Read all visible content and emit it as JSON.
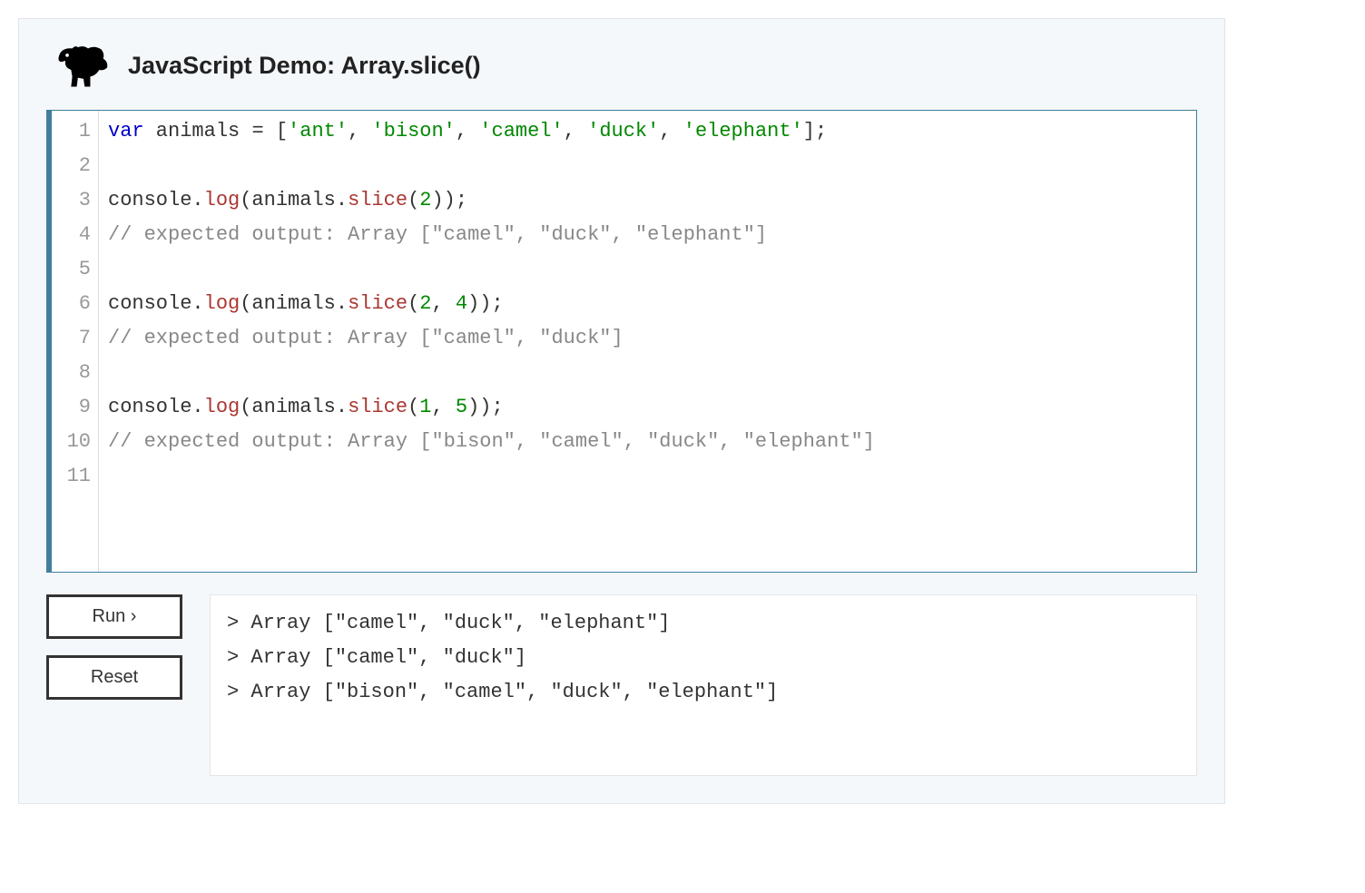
{
  "header": {
    "title": "JavaScript Demo: Array.slice()"
  },
  "editor": {
    "line_numbers": [
      "1",
      "2",
      "3",
      "4",
      "5",
      "6",
      "7",
      "8",
      "9",
      "10",
      "11"
    ],
    "lines": [
      [
        {
          "t": "var",
          "c": "tok-kw"
        },
        {
          "t": " animals ",
          "c": "tok-punc"
        },
        {
          "t": "=",
          "c": "tok-punc"
        },
        {
          "t": " [",
          "c": "tok-punc"
        },
        {
          "t": "'ant'",
          "c": "tok-str"
        },
        {
          "t": ", ",
          "c": "tok-punc"
        },
        {
          "t": "'bison'",
          "c": "tok-str"
        },
        {
          "t": ", ",
          "c": "tok-punc"
        },
        {
          "t": "'camel'",
          "c": "tok-str"
        },
        {
          "t": ", ",
          "c": "tok-punc"
        },
        {
          "t": "'duck'",
          "c": "tok-str"
        },
        {
          "t": ", ",
          "c": "tok-punc"
        },
        {
          "t": "'elephant'",
          "c": "tok-str"
        },
        {
          "t": "];",
          "c": "tok-punc"
        }
      ],
      [],
      [
        {
          "t": "console.",
          "c": "tok-punc"
        },
        {
          "t": "log",
          "c": "tok-method"
        },
        {
          "t": "(animals.",
          "c": "tok-punc"
        },
        {
          "t": "slice",
          "c": "tok-method"
        },
        {
          "t": "(",
          "c": "tok-punc"
        },
        {
          "t": "2",
          "c": "tok-num"
        },
        {
          "t": "));",
          "c": "tok-punc"
        }
      ],
      [
        {
          "t": "// expected output: Array [\"camel\", \"duck\", \"elephant\"]",
          "c": "tok-cmt"
        }
      ],
      [],
      [
        {
          "t": "console.",
          "c": "tok-punc"
        },
        {
          "t": "log",
          "c": "tok-method"
        },
        {
          "t": "(animals.",
          "c": "tok-punc"
        },
        {
          "t": "slice",
          "c": "tok-method"
        },
        {
          "t": "(",
          "c": "tok-punc"
        },
        {
          "t": "2",
          "c": "tok-num"
        },
        {
          "t": ", ",
          "c": "tok-punc"
        },
        {
          "t": "4",
          "c": "tok-num"
        },
        {
          "t": "));",
          "c": "tok-punc"
        }
      ],
      [
        {
          "t": "// expected output: Array [\"camel\", \"duck\"]",
          "c": "tok-cmt"
        }
      ],
      [],
      [
        {
          "t": "console.",
          "c": "tok-punc"
        },
        {
          "t": "log",
          "c": "tok-method"
        },
        {
          "t": "(animals.",
          "c": "tok-punc"
        },
        {
          "t": "slice",
          "c": "tok-method"
        },
        {
          "t": "(",
          "c": "tok-punc"
        },
        {
          "t": "1",
          "c": "tok-num"
        },
        {
          "t": ", ",
          "c": "tok-punc"
        },
        {
          "t": "5",
          "c": "tok-num"
        },
        {
          "t": "));",
          "c": "tok-punc"
        }
      ],
      [
        {
          "t": "// expected output: Array [\"bison\", \"camel\", \"duck\", \"elephant\"]",
          "c": "tok-cmt"
        }
      ],
      []
    ]
  },
  "buttons": {
    "run": "Run ›",
    "reset": "Reset"
  },
  "console": {
    "lines": [
      "> Array [\"camel\", \"duck\", \"elephant\"]",
      "> Array [\"camel\", \"duck\"]",
      "> Array [\"bison\", \"camel\", \"duck\", \"elephant\"]"
    ]
  }
}
